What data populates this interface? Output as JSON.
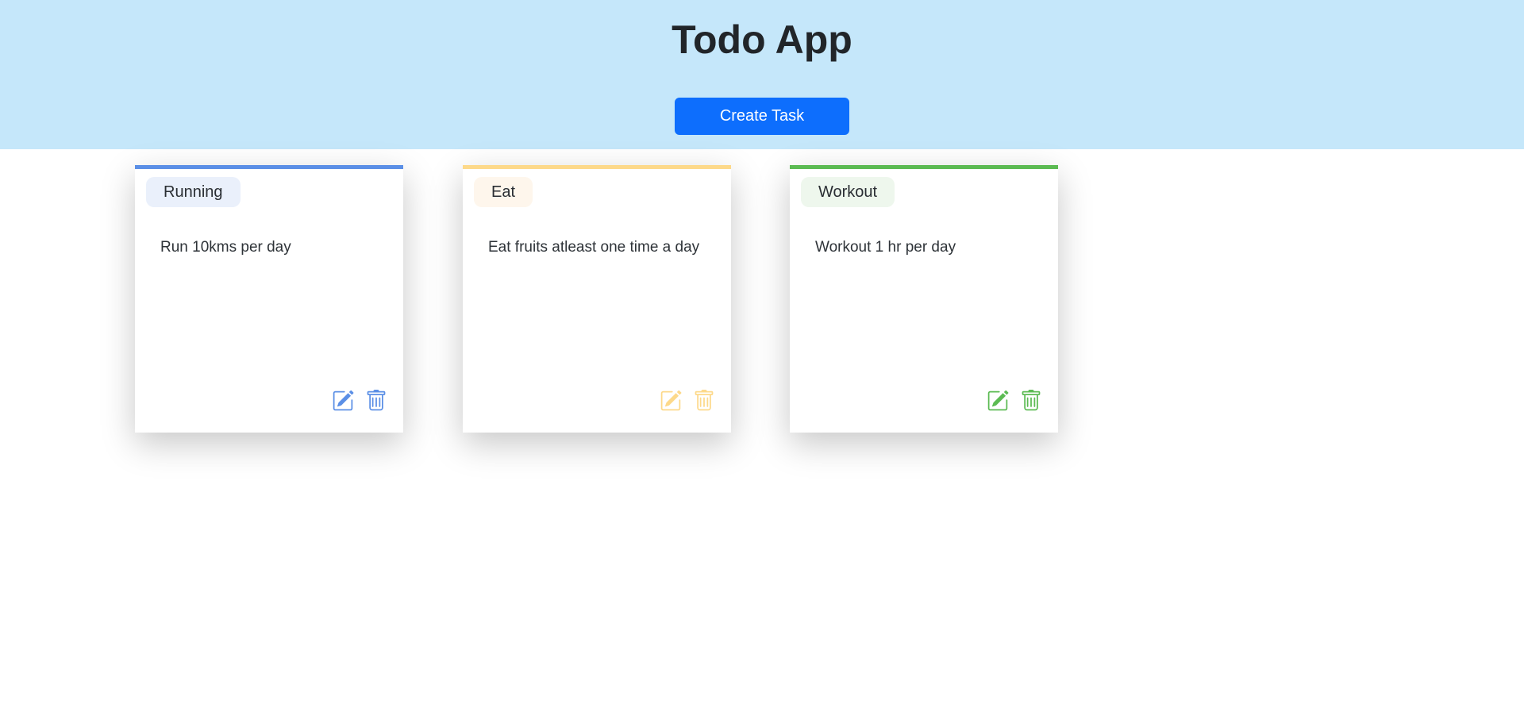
{
  "header": {
    "title": "Todo App",
    "create_label": "Create Task"
  },
  "colors": {
    "header_bg": "#c5e7fa",
    "primary": "#0d6efd"
  },
  "tasks": [
    {
      "tag": "Running",
      "description": "Run 10kms per day",
      "accent": "#5b8fe6",
      "tag_bg": "#eaf0fb",
      "edit_icon": "pencil-square-icon",
      "delete_icon": "trash-icon"
    },
    {
      "tag": "Eat",
      "description": "Eat fruits atleast one time a day",
      "accent": "#fdd98a",
      "tag_bg": "#fef6ec",
      "edit_icon": "pencil-square-icon",
      "delete_icon": "trash-icon"
    },
    {
      "tag": "Workout",
      "description": "Workout 1 hr per day",
      "accent": "#5cbb53",
      "tag_bg": "#eef7ed",
      "edit_icon": "pencil-square-icon",
      "delete_icon": "trash-icon"
    }
  ]
}
